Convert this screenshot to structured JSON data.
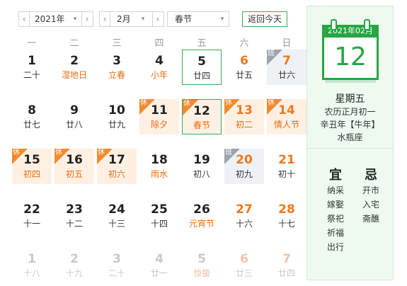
{
  "toolbar": {
    "year_value": "2021年",
    "month_value": "2月",
    "holiday_value": "春节",
    "prev_arrow": "‹",
    "next_arrow": "›",
    "caret": "▾",
    "today_button": "返回今天"
  },
  "weekdays": [
    "一",
    "二",
    "三",
    "四",
    "五",
    "六",
    "日"
  ],
  "tags": {
    "holiday": "休",
    "work": "班"
  },
  "colors": {
    "accent": "#27a644",
    "festival": "#e36c12",
    "holiday_bg": "#fff0e3",
    "work_bg": "#eef1f5"
  },
  "rows": [
    [
      {
        "n": "1",
        "s": "二十",
        "k": "norm"
      },
      {
        "n": "2",
        "s": "湿地日",
        "k": "fest"
      },
      {
        "n": "3",
        "s": "立春",
        "k": "fest"
      },
      {
        "n": "4",
        "s": "小年",
        "k": "fest"
      },
      {
        "n": "5",
        "s": "廿四",
        "k": "norm",
        "selected": true
      },
      {
        "n": "6",
        "s": "廿五",
        "k": "weekend"
      },
      {
        "n": "7",
        "s": "廿六",
        "k": "weekend",
        "tag": "work"
      }
    ],
    [
      {
        "n": "8",
        "s": "廿七",
        "k": "norm"
      },
      {
        "n": "9",
        "s": "廿八",
        "k": "norm"
      },
      {
        "n": "10",
        "s": "廿九",
        "k": "norm"
      },
      {
        "n": "11",
        "s": "除夕",
        "k": "hfest",
        "tag": "holiday"
      },
      {
        "n": "12",
        "s": "春节",
        "k": "hfest",
        "tag": "holiday",
        "selected": true
      },
      {
        "n": "13",
        "s": "初二",
        "k": "hweek",
        "tag": "holiday"
      },
      {
        "n": "14",
        "s": "情人节",
        "k": "hweekfest",
        "tag": "holiday"
      }
    ],
    [
      {
        "n": "15",
        "s": "初四",
        "k": "hfest",
        "tag": "holiday"
      },
      {
        "n": "16",
        "s": "初五",
        "k": "hnorm",
        "tag": "holiday"
      },
      {
        "n": "17",
        "s": "初六",
        "k": "hnorm",
        "tag": "holiday"
      },
      {
        "n": "18",
        "s": "雨水",
        "k": "fest"
      },
      {
        "n": "19",
        "s": "初八",
        "k": "norm"
      },
      {
        "n": "20",
        "s": "初九",
        "k": "weekend",
        "tag": "work"
      },
      {
        "n": "21",
        "s": "初十",
        "k": "weekend"
      }
    ],
    [
      {
        "n": "22",
        "s": "十一",
        "k": "norm"
      },
      {
        "n": "23",
        "s": "十二",
        "k": "norm"
      },
      {
        "n": "24",
        "s": "十三",
        "k": "norm"
      },
      {
        "n": "25",
        "s": "十四",
        "k": "norm"
      },
      {
        "n": "26",
        "s": "元宵节",
        "k": "fest"
      },
      {
        "n": "27",
        "s": "十六",
        "k": "weekend"
      },
      {
        "n": "28",
        "s": "十七",
        "k": "weekend"
      }
    ],
    [
      {
        "n": "1",
        "s": "十八",
        "k": "grey"
      },
      {
        "n": "2",
        "s": "十九",
        "k": "grey"
      },
      {
        "n": "3",
        "s": "二十",
        "k": "grey"
      },
      {
        "n": "4",
        "s": "廿一",
        "k": "grey"
      },
      {
        "n": "5",
        "s": "惊蛰",
        "k": "greyfest"
      },
      {
        "n": "6",
        "s": "廿三",
        "k": "greyweekend"
      },
      {
        "n": "7",
        "s": "廿四",
        "k": "greyweekend"
      }
    ]
  ],
  "panel": {
    "cal_header": "2021年02月",
    "cal_day": "12",
    "weekday": "星期五",
    "lunar": "农历正月初一",
    "ganzhi": "辛丑年【牛年】",
    "constellation": "水瓶座",
    "yi_title": "宜",
    "ji_title": "忌",
    "yi_items": [
      "纳采",
      "嫁娶",
      "祭祀",
      "祈福",
      "出行"
    ],
    "ji_items": [
      "开市",
      "入宅",
      "斋醮"
    ]
  }
}
